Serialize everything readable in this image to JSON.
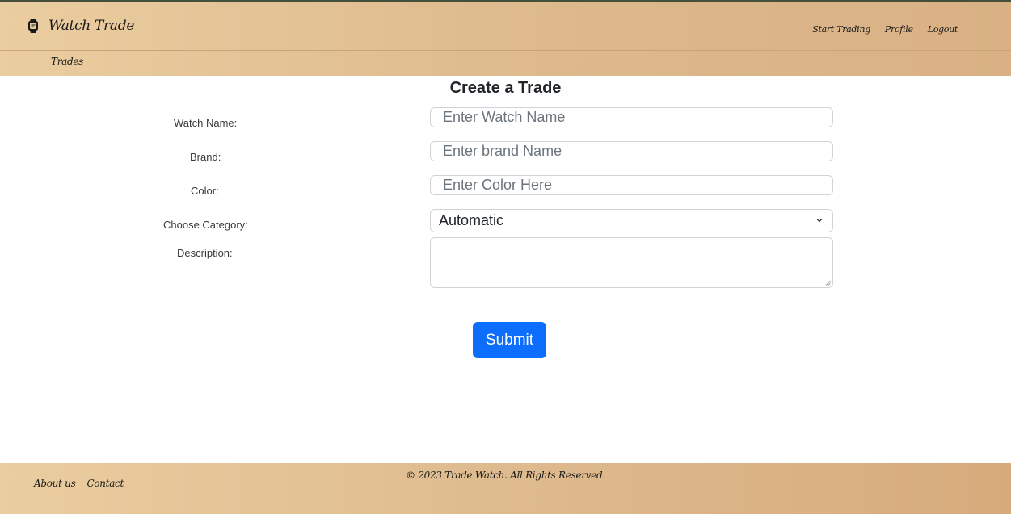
{
  "header": {
    "brand": "Watch Trade",
    "nav": [
      "Start Trading",
      "Profile",
      "Logout"
    ],
    "subnav": "Trades"
  },
  "page": {
    "title": "Create a Trade"
  },
  "form": {
    "watch_name": {
      "label": "Watch Name:",
      "placeholder": "Enter Watch Name"
    },
    "brand": {
      "label": "Brand:",
      "placeholder": "Enter brand Name"
    },
    "color": {
      "label": "Color:",
      "placeholder": "Enter Color Here"
    },
    "category": {
      "label": "Choose Category:",
      "selected": "Automatic"
    },
    "description": {
      "label": "Description:"
    },
    "submit_label": "Submit"
  },
  "footer": {
    "links": [
      "About us",
      "Contact"
    ],
    "copyright": "© 2023 Trade Watch. All Rights Reserved."
  },
  "colors": {
    "header_gradient_start": "#eacda0",
    "header_gradient_end": "#d9b184",
    "primary_button": "#0d6efd"
  },
  "icons": {
    "logo": "watch-icon",
    "select": "chevron-down-icon"
  }
}
